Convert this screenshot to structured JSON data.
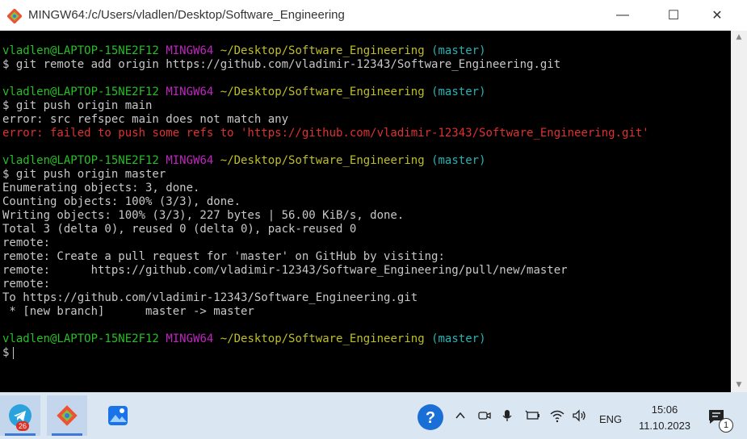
{
  "window": {
    "title": "MINGW64:/c/Users/vladlen/Desktop/Software_Engineering",
    "controls": {
      "minimize": "—",
      "maximize": "☐",
      "close": "✕"
    }
  },
  "terminal": {
    "lines": [
      {
        "type": "prompt",
        "user": "vladlen@LAPTOP-15NE2F12",
        "system": "MINGW64",
        "path": "~/Desktop/Software_Engineering",
        "branch": "(master)"
      },
      {
        "type": "text",
        "text": "$ git remote add origin https://github.com/vladimir-12343/Software_Engineering.git"
      },
      {
        "type": "blank",
        "text": ""
      },
      {
        "type": "prompt",
        "user": "vladlen@LAPTOP-15NE2F12",
        "system": "MINGW64",
        "path": "~/Desktop/Software_Engineering",
        "branch": "(master)"
      },
      {
        "type": "text",
        "text": "$ git push origin main"
      },
      {
        "type": "text",
        "text": "error: src refspec main does not match any"
      },
      {
        "type": "error",
        "text": "error: failed to push some refs to 'https://github.com/vladimir-12343/Software_Engineering.git'"
      },
      {
        "type": "blank",
        "text": ""
      },
      {
        "type": "prompt",
        "user": "vladlen@LAPTOP-15NE2F12",
        "system": "MINGW64",
        "path": "~/Desktop/Software_Engineering",
        "branch": "(master)"
      },
      {
        "type": "text",
        "text": "$ git push origin master"
      },
      {
        "type": "text",
        "text": "Enumerating objects: 3, done."
      },
      {
        "type": "text",
        "text": "Counting objects: 100% (3/3), done."
      },
      {
        "type": "text",
        "text": "Writing objects: 100% (3/3), 227 bytes | 56.00 KiB/s, done."
      },
      {
        "type": "text",
        "text": "Total 3 (delta 0), reused 0 (delta 0), pack-reused 0"
      },
      {
        "type": "text",
        "text": "remote:"
      },
      {
        "type": "text",
        "text": "remote: Create a pull request for 'master' on GitHub by visiting:"
      },
      {
        "type": "text",
        "text": "remote:      https://github.com/vladimir-12343/Software_Engineering/pull/new/master"
      },
      {
        "type": "text",
        "text": "remote:"
      },
      {
        "type": "text",
        "text": "To https://github.com/vladimir-12343/Software_Engineering.git"
      },
      {
        "type": "text",
        "text": " * [new branch]      master -> master"
      },
      {
        "type": "blank",
        "text": ""
      },
      {
        "type": "prompt",
        "user": "vladlen@LAPTOP-15NE2F12",
        "system": "MINGW64",
        "path": "~/Desktop/Software_Engineering",
        "branch": "(master)"
      },
      {
        "type": "input",
        "text": "$"
      }
    ]
  },
  "taskbar": {
    "apps": [
      {
        "name": "telegram-app",
        "badge": "26"
      },
      {
        "name": "git-bash-app"
      },
      {
        "name": "photos-app"
      }
    ],
    "help_icon": "?",
    "language": "ENG",
    "time": "15:06",
    "date": "11.10.2023",
    "notification_count": "1"
  },
  "colors": {
    "terminal_bg": "#000000",
    "user": "#26bf26",
    "system": "#bf26bf",
    "path": "#bfbf26",
    "branch": "#26b3b3",
    "error": "#e03030",
    "text": "#c8c8c8"
  }
}
